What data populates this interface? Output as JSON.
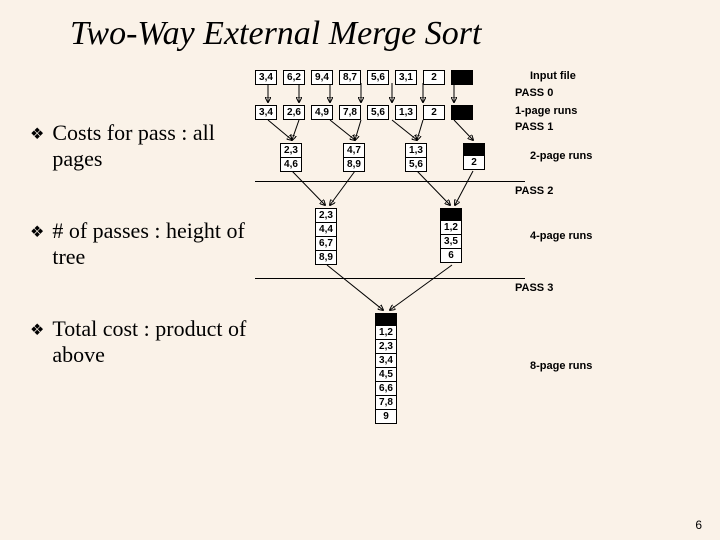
{
  "title": "Two-Way External Merge Sort",
  "bullets": [
    {
      "text": "Costs for pass : all pages"
    },
    {
      "text": "# of passes : height of tree"
    },
    {
      "text": "Total cost : product of above"
    }
  ],
  "labels": {
    "input": "Input file",
    "pass0": "PASS 0",
    "runs1": "1-page runs",
    "pass1": "PASS 1",
    "runs2": "2-page runs",
    "pass2": "PASS 2",
    "runs4": "4-page runs",
    "pass3": "PASS 3",
    "runs8": "8-page runs"
  },
  "row_input": [
    "3,4",
    "6,2",
    "9,4",
    "8,7",
    "5,6",
    "3,1",
    "2"
  ],
  "row_pass0": [
    "3,4",
    "2,6",
    "4,9",
    "7,8",
    "5,6",
    "1,3",
    "2"
  ],
  "pair_a": [
    "2,3",
    "4,6"
  ],
  "pair_b": [
    "4,7",
    "8,9"
  ],
  "pair_c": [
    "1,3",
    "5,6"
  ],
  "pair_d_single": "2",
  "quad_a": [
    "2,3",
    "4,4",
    "6,7",
    "8,9"
  ],
  "quad_b": [
    "1,2",
    "3,5",
    "6"
  ],
  "final": [
    "1,2",
    "2,3",
    "3,4",
    "4,5",
    "6,6",
    "7,8",
    "9"
  ],
  "slide_number": "6"
}
